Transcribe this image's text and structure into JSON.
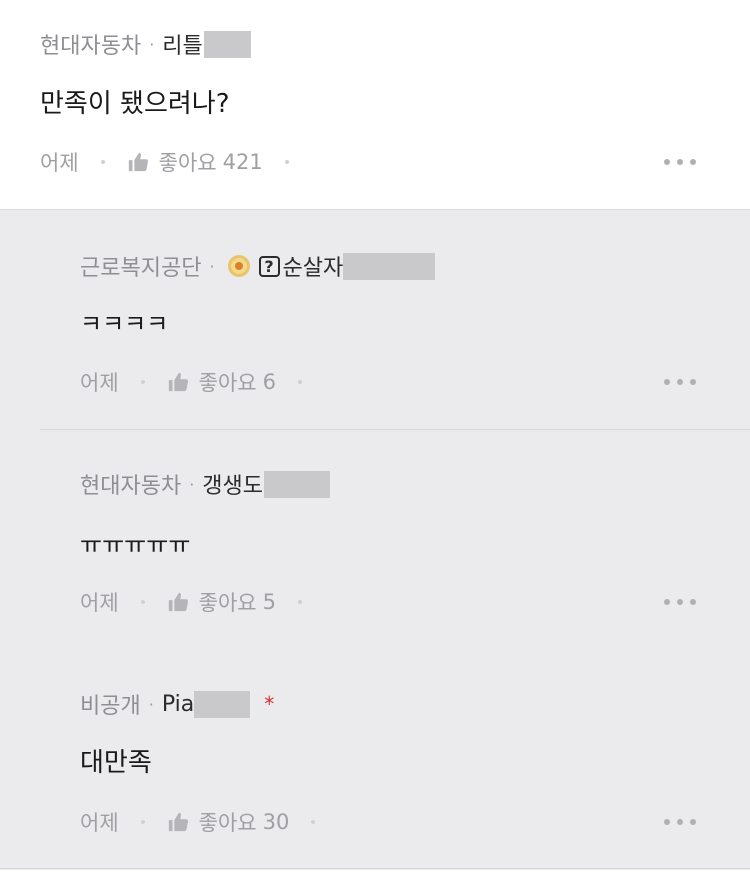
{
  "post": {
    "company": "현대자동차",
    "separator": "·",
    "nickname": "리틀",
    "content": "만족이 됐으려나?",
    "time": "어제",
    "like_label": "좋아요",
    "like_count": "421"
  },
  "replies": [
    {
      "company": "근로복지공단",
      "separator": "·",
      "nickname": "순살자",
      "question_mark": "?",
      "content": "ㅋㅋㅋㅋ",
      "time": "어제",
      "like_label": "좋아요",
      "like_count": "6"
    },
    {
      "company": "현대자동차",
      "separator": "·",
      "nickname": "갱생도",
      "content": "ㅠㅠㅠㅠㅠ",
      "time": "어제",
      "like_label": "좋아요",
      "like_count": "5"
    },
    {
      "company": "비공개",
      "separator": "·",
      "nickname": "Pia",
      "star": "*",
      "content": "대만족",
      "time": "어제",
      "like_label": "좋아요",
      "like_count": "30"
    }
  ],
  "icons": {
    "like": "thumbs-up-icon",
    "more": "more-options-icon",
    "badge": "gold-badge-icon"
  },
  "colors": {
    "reply_background": "#ebebee",
    "star_accent": "#d0312d"
  }
}
